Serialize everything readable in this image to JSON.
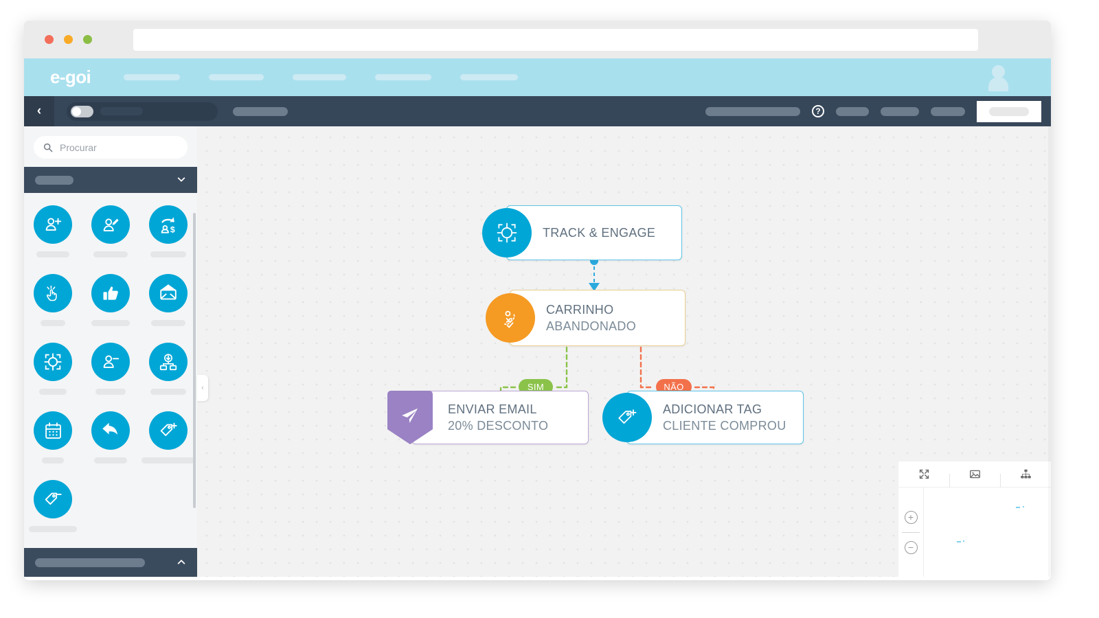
{
  "browser": {
    "traffic_lights": [
      "close",
      "minimize",
      "maximize"
    ],
    "address_bar_value": "",
    "address_bar_placeholder": ""
  },
  "topnav": {
    "brand": "e-goi",
    "nav_placeholders": 5,
    "avatar": "user-avatar"
  },
  "toolbar": {
    "back_icon": "‹",
    "toggle_state": "off",
    "help_icon": "?",
    "placeholder_pills": 5,
    "primary_button_label": ""
  },
  "sidebar": {
    "search": {
      "placeholder": "Procurar",
      "value": ""
    },
    "group_header_label": "",
    "group_footer_label": "",
    "tools": [
      {
        "icon": "user-add-icon",
        "label": "",
        "label_width": 48
      },
      {
        "icon": "user-edit-icon",
        "label": "",
        "label_width": 50
      },
      {
        "icon": "user-sale-icon",
        "label": "",
        "label_width": 52
      },
      {
        "icon": "click-icon",
        "label": "",
        "label_width": 36
      },
      {
        "icon": "thumbs-up-icon",
        "label": "",
        "label_width": 56
      },
      {
        "icon": "open-envelope-icon",
        "label": "",
        "label_width": 50
      },
      {
        "icon": "target-icon",
        "label": "",
        "label_width": 40
      },
      {
        "icon": "user-remove-icon",
        "label": "",
        "label_width": 44
      },
      {
        "icon": "form-download-icon",
        "label": "",
        "label_width": 52
      },
      {
        "icon": "calendar-icon",
        "label": "",
        "label_width": 32
      },
      {
        "icon": "reply-arrow-icon",
        "label": "",
        "label_width": 48
      },
      {
        "icon": "tag-add-icon",
        "label": "",
        "label_width": 78
      },
      {
        "icon": "tag-remove-icon",
        "label": "",
        "label_width": 70
      }
    ],
    "collapse_icon": "‹"
  },
  "canvas": {
    "nodes": [
      {
        "id": "track",
        "title": "TRACK & ENGAGE",
        "subtitle": "",
        "icon": "target-crosshair-icon",
        "accent": "#00a6d6"
      },
      {
        "id": "cart",
        "title": "CARRINHO",
        "subtitle": "ABANDONADO",
        "icon": "decision-check-x-icon",
        "accent": "#f59a23"
      },
      {
        "id": "email",
        "title": "ENVIAR EMAIL",
        "subtitle": "20% DESCONTO",
        "icon": "paper-plane-icon",
        "accent": "#9a82c4"
      },
      {
        "id": "tag",
        "title": "ADICIONAR TAG",
        "subtitle": "CLIENTE COMPROU",
        "icon": "tag-add-icon",
        "accent": "#00a6d6"
      }
    ],
    "branch_labels": [
      {
        "id": "sim",
        "text": "SIM",
        "color": "#8bc34a"
      },
      {
        "id": "nao",
        "text": "NÃO",
        "color": "#f2714b"
      }
    ]
  },
  "minimap": {
    "tools": [
      {
        "icon": "fullscreen-icon"
      },
      {
        "icon": "image-export-icon"
      },
      {
        "icon": "hierarchy-icon"
      }
    ],
    "zoom_in_icon": "+",
    "zoom_out_icon": "−"
  }
}
